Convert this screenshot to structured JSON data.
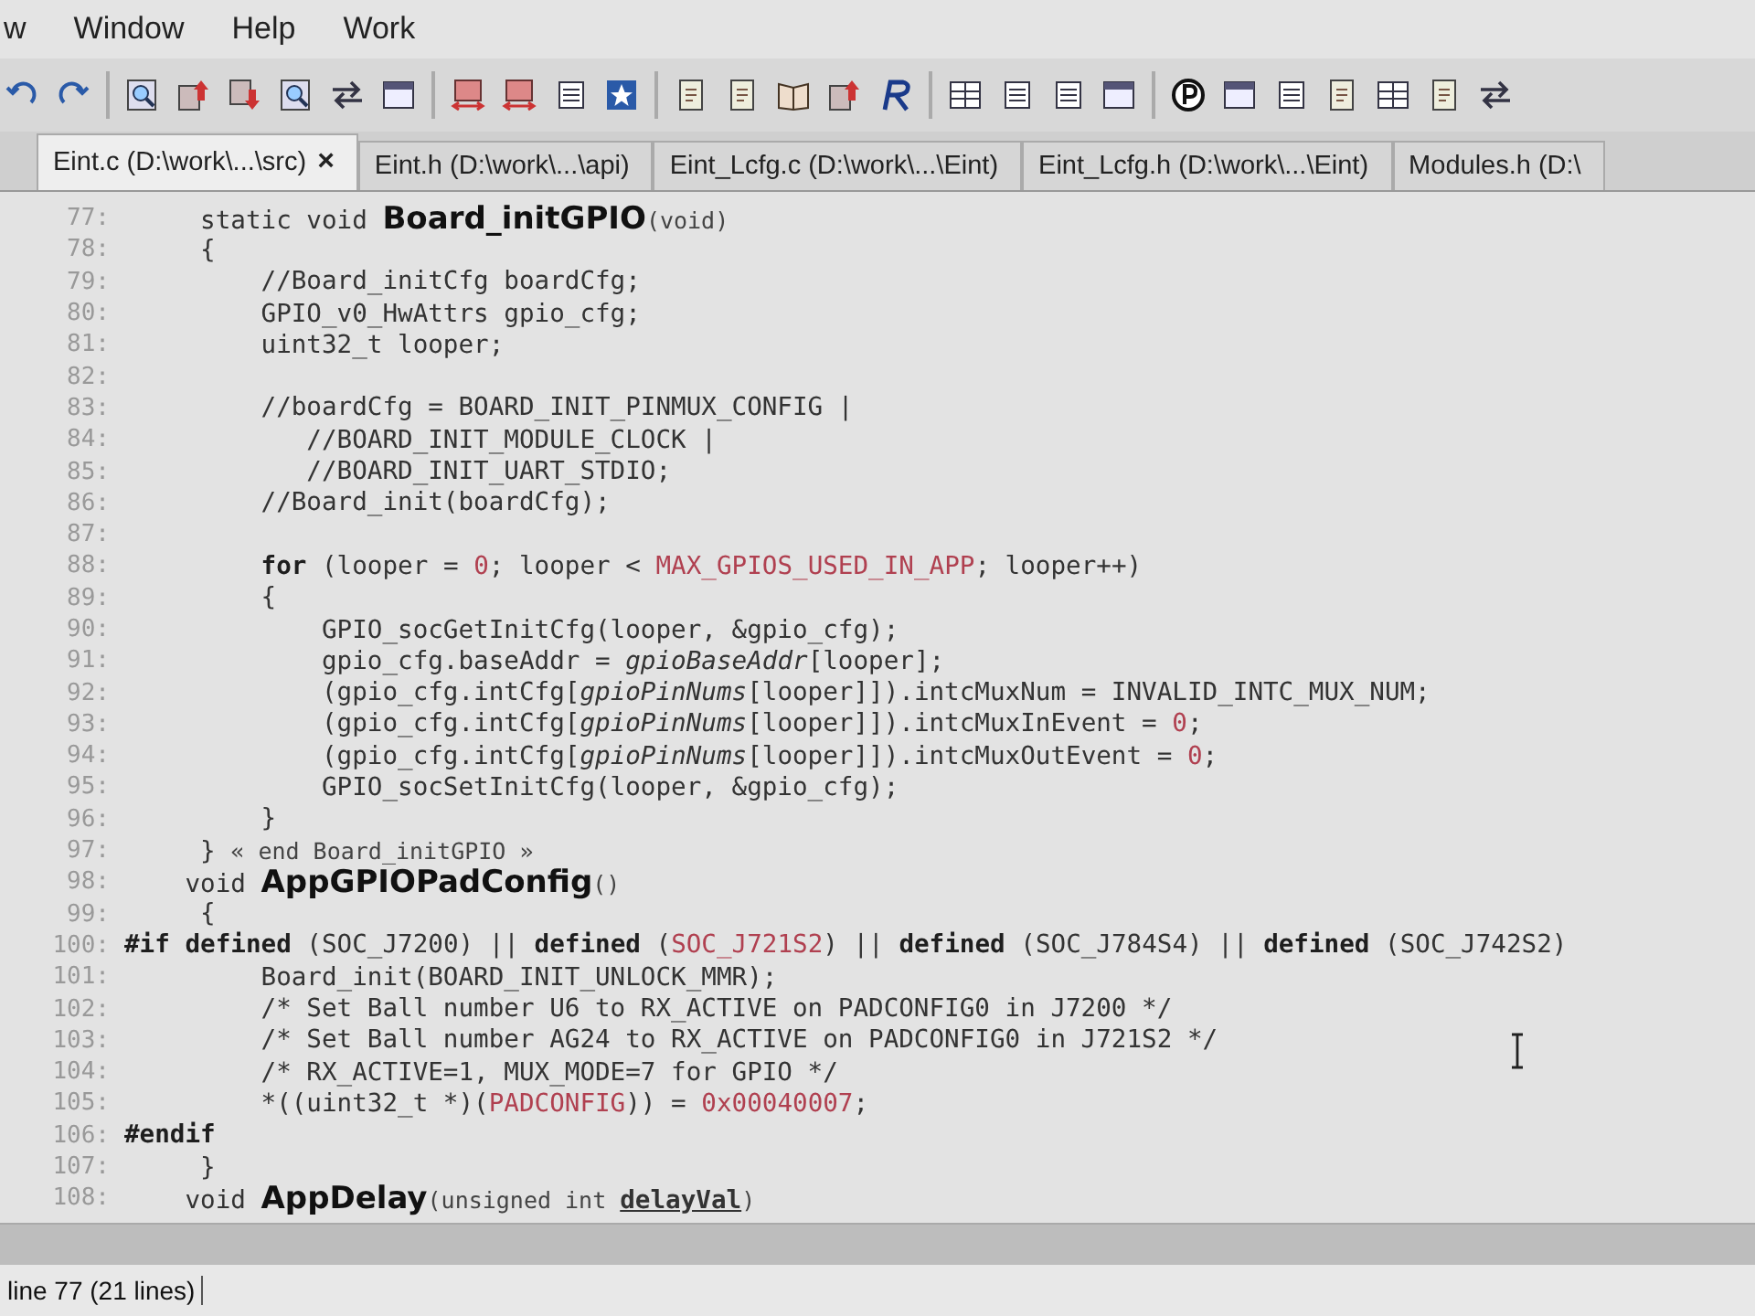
{
  "menu": [
    "w",
    "Window",
    "Help",
    "Work"
  ],
  "tabs": [
    {
      "label": "Eint.c (D:\\work\\...\\src)",
      "close": "×",
      "selected": true
    },
    {
      "label": "Eint.h (D:\\work\\...\\api)",
      "selected": false
    },
    {
      "label": "Eint_Lcfg.c (D:\\work\\...\\Eint)",
      "selected": false
    },
    {
      "label": "Eint_Lcfg.h (D:\\work\\...\\Eint)",
      "selected": false
    },
    {
      "label": "Modules.h (D:\\",
      "selected": false
    }
  ],
  "editor": {
    "lines": [
      {
        "number": "77:",
        "code": [
          {
            "kind": "plain",
            "text": "     static void "
          },
          {
            "kind": "fn",
            "text": "Board_initGPIO"
          },
          {
            "kind": "small",
            "text": "(void)"
          }
        ]
      },
      {
        "number": "78:",
        "code": [
          {
            "kind": "plain",
            "text": "     {"
          }
        ]
      },
      {
        "number": "79:",
        "code": [
          {
            "kind": "plain",
            "text": "         //Board_initCfg boardCfg;"
          }
        ]
      },
      {
        "number": "80:",
        "code": [
          {
            "kind": "plain",
            "text": "         GPIO_v0_HwAttrs gpio_cfg;"
          }
        ]
      },
      {
        "number": "81:",
        "code": [
          {
            "kind": "plain",
            "text": "         uint32_t looper;"
          }
        ]
      },
      {
        "number": "82:"
      },
      {
        "number": "83:",
        "code": [
          {
            "kind": "plain",
            "text": "         //boardCfg = BOARD_INIT_PINMUX_CONFIG |"
          }
        ]
      },
      {
        "number": "84:",
        "code": [
          {
            "kind": "plain",
            "text": "            //BOARD_INIT_MODULE_CLOCK |"
          }
        ]
      },
      {
        "number": "85:",
        "code": [
          {
            "kind": "plain",
            "text": "            //BOARD_INIT_UART_STDIO;"
          }
        ]
      },
      {
        "number": "86:",
        "code": [
          {
            "kind": "plain",
            "text": "         //Board_init(boardCfg);"
          }
        ]
      },
      {
        "number": "87:"
      },
      {
        "number": "88:",
        "code": [
          {
            "kind": "kw",
            "text": "         for"
          },
          {
            "kind": "plain",
            "text": " (looper = "
          },
          {
            "kind": "macro",
            "text": "0"
          },
          {
            "kind": "plain",
            "text": "; looper < "
          },
          {
            "kind": "macro",
            "text": "MAX_GPIOS_USED_IN_APP"
          },
          {
            "kind": "plain",
            "text": "; looper++)"
          }
        ]
      },
      {
        "number": "89:",
        "code": [
          {
            "kind": "plain",
            "text": "         {"
          }
        ]
      },
      {
        "number": "90:",
        "code": [
          {
            "kind": "plain",
            "text": "             GPIO_socGetInitCfg(looper, &gpio_cfg);"
          }
        ]
      },
      {
        "number": "91:",
        "code": [
          {
            "kind": "plain",
            "text": "             gpio_cfg.baseAddr = "
          },
          {
            "kind": "italic",
            "text": "gpioBaseAddr"
          },
          {
            "kind": "plain",
            "text": "[looper];"
          }
        ]
      },
      {
        "number": "92:",
        "code": [
          {
            "kind": "plain",
            "text": "             (gpio_cfg.intCfg["
          },
          {
            "kind": "italic",
            "text": "gpioPinNums"
          },
          {
            "kind": "plain",
            "text": "[looper]]).intcMuxNum = INVALID_INTC_MUX_NUM;"
          }
        ]
      },
      {
        "number": "93:",
        "code": [
          {
            "kind": "plain",
            "text": "             (gpio_cfg.intCfg["
          },
          {
            "kind": "italic",
            "text": "gpioPinNums"
          },
          {
            "kind": "plain",
            "text": "[looper]]).intcMuxInEvent = "
          },
          {
            "kind": "macro",
            "text": "0"
          },
          {
            "kind": "plain",
            "text": ";"
          }
        ]
      },
      {
        "number": "94:",
        "code": [
          {
            "kind": "plain",
            "text": "             (gpio_cfg.intCfg["
          },
          {
            "kind": "italic",
            "text": "gpioPinNums"
          },
          {
            "kind": "plain",
            "text": "[looper]]).intcMuxOutEvent = "
          },
          {
            "kind": "macro",
            "text": "0"
          },
          {
            "kind": "plain",
            "text": ";"
          }
        ]
      },
      {
        "number": "95:",
        "code": [
          {
            "kind": "plain",
            "text": "             GPIO_socSetInitCfg(looper, &gpio_cfg);"
          }
        ]
      },
      {
        "number": "96:",
        "code": [
          {
            "kind": "plain",
            "text": "         }"
          }
        ]
      },
      {
        "number": "97:",
        "code": [
          {
            "kind": "plain",
            "text": "     } "
          },
          {
            "kind": "small",
            "text": "« end Board_initGPIO »"
          }
        ]
      },
      {
        "number": "98:",
        "code": [
          {
            "kind": "plain",
            "text": "    void "
          },
          {
            "kind": "fn",
            "text": "AppGPIOPadConfig"
          },
          {
            "kind": "small",
            "text": "()"
          }
        ]
      },
      {
        "number": "99:",
        "code": [
          {
            "kind": "plain",
            "text": "     {"
          }
        ]
      },
      {
        "number": "100:",
        "code": [
          {
            "kind": "kw",
            "text": "#if defined"
          },
          {
            "kind": "plain",
            "text": " (SOC_J7200) || "
          },
          {
            "kind": "kw",
            "text": "defined"
          },
          {
            "kind": "plain",
            "text": " ("
          },
          {
            "kind": "macro",
            "text": "SOC_J721S2"
          },
          {
            "kind": "plain",
            "text": ") || "
          },
          {
            "kind": "kw",
            "text": "defined"
          },
          {
            "kind": "plain",
            "text": " (SOC_J784S4) || "
          },
          {
            "kind": "kw",
            "text": "defined"
          },
          {
            "kind": "plain",
            "text": " (SOC_J742S2)"
          }
        ]
      },
      {
        "number": "101:",
        "code": [
          {
            "kind": "plain",
            "text": "         Board_init(BOARD_INIT_UNLOCK_MMR);"
          }
        ]
      },
      {
        "number": "102:",
        "code": [
          {
            "kind": "plain",
            "text": "         /* Set Ball number U6 to RX_ACTIVE on PADCONFIG0 in J7200 */"
          }
        ]
      },
      {
        "number": "103:",
        "code": [
          {
            "kind": "plain",
            "text": "         /* Set Ball number AG24 to RX_ACTIVE on PADCONFIG0 in J721S2 */"
          }
        ]
      },
      {
        "number": "104:",
        "code": [
          {
            "kind": "plain",
            "text": "         /* RX_ACTIVE=1, MUX_MODE=7 for GPIO */"
          }
        ]
      },
      {
        "number": "105:",
        "code": [
          {
            "kind": "plain",
            "text": "         *((uint32_t *)("
          },
          {
            "kind": "macro",
            "text": "PADCONFIG"
          },
          {
            "kind": "plain",
            "text": ")) = "
          },
          {
            "kind": "macro",
            "text": "0x00040007"
          },
          {
            "kind": "plain",
            "text": ";"
          }
        ]
      },
      {
        "number": "106:",
        "code": [
          {
            "kind": "kw",
            "text": "#endif"
          }
        ]
      },
      {
        "number": "107:",
        "code": [
          {
            "kind": "plain",
            "text": "     }"
          }
        ]
      },
      {
        "number": "108:",
        "code": [
          {
            "kind": "plain",
            "text": "    void "
          },
          {
            "kind": "fn",
            "text": "AppDelay"
          },
          {
            "kind": "small",
            "text": "(unsigned int "
          },
          {
            "kind": "under",
            "text": "delayVal"
          },
          {
            "kind": "small",
            "text": ")"
          }
        ]
      }
    ]
  },
  "status_bar": {
    "position": "line 77 (21 lines)"
  }
}
